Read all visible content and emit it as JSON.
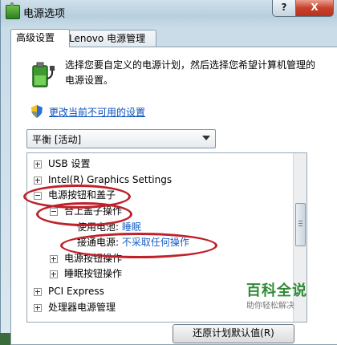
{
  "window": {
    "title": "电源选项",
    "help_label": "?",
    "close_label": "X"
  },
  "tabs": [
    {
      "label": "高级设置",
      "active": true
    },
    {
      "label": "Lenovo 电源管理",
      "active": false
    }
  ],
  "description": "选择您要自定义的电源计划，然后选择您希望计算机管理的电源设置。",
  "change_link": "更改当前不可用的设置",
  "plan_select": {
    "value": "平衡 [活动]"
  },
  "tree": {
    "items": [
      {
        "label": "USB 设置",
        "expander": "plus"
      },
      {
        "label": "Intel(R) Graphics Settings",
        "expander": "plus"
      },
      {
        "label": "电源按钮和盖子",
        "expander": "minus"
      },
      {
        "label": "合上盖子操作",
        "expander": "minus"
      },
      {
        "label": "使用电池:",
        "value": "睡眠"
      },
      {
        "label": "接通电源:",
        "value": "不采取任何操作"
      },
      {
        "label": "电源按钮操作",
        "expander": "plus"
      },
      {
        "label": "睡眠按钮操作",
        "expander": "plus"
      },
      {
        "label": "PCI Express",
        "expander": "plus"
      },
      {
        "label": "处理器电源管理",
        "expander": "plus"
      }
    ]
  },
  "restore_button": "还原计划默认值(R)",
  "watermark": {
    "title": "百科全说",
    "subtitle": "助你轻松解决"
  },
  "colors": {
    "highlight_ellipse": "#c0202a",
    "link": "#0a4fbf",
    "watermark_green": "#2f8a35"
  }
}
